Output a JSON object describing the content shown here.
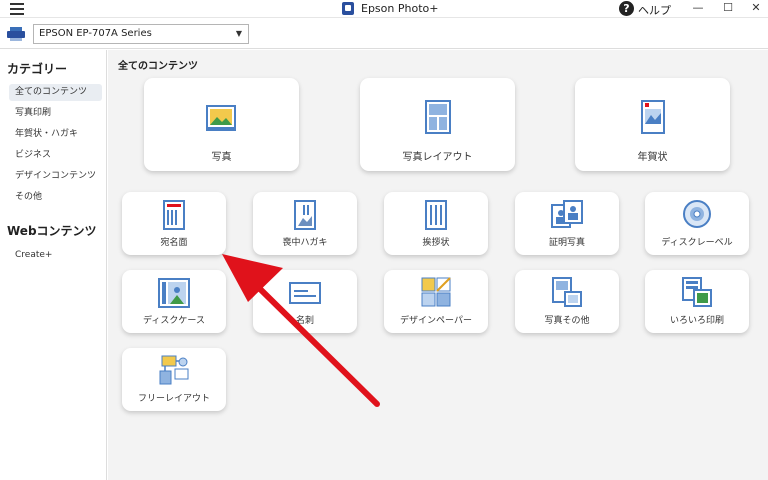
{
  "titlebar": {
    "app_title": "Epson Photo+",
    "help_label": "ヘルプ",
    "minimize": "—",
    "maximize": "☐",
    "close": "✕"
  },
  "toolbar": {
    "printer_name": "EPSON EP-707A Series"
  },
  "sidebar": {
    "category_heading": "カテゴリー",
    "items": [
      "全てのコンテンツ",
      "写真印刷",
      "年賀状・ハガキ",
      "ビジネス",
      "デザインコンテンツ",
      "その他"
    ],
    "web_heading": "Webコンテンツ",
    "web_items": [
      "Create+"
    ]
  },
  "main": {
    "title": "全てのコンテンツ",
    "large_cards": [
      "写真",
      "写真レイアウト",
      "年賀状"
    ],
    "small_cards": [
      "宛名面",
      "喪中ハガキ",
      "挨拶状",
      "証明写真",
      "ディスクレーベル",
      "ディスクケース",
      "名刺",
      "デザインペーパー",
      "写真その他",
      "いろいろ印刷",
      "フリーレイアウト"
    ]
  },
  "colors": {
    "accent": "#3a6fb8",
    "annotation_arrow": "#e0121b"
  }
}
